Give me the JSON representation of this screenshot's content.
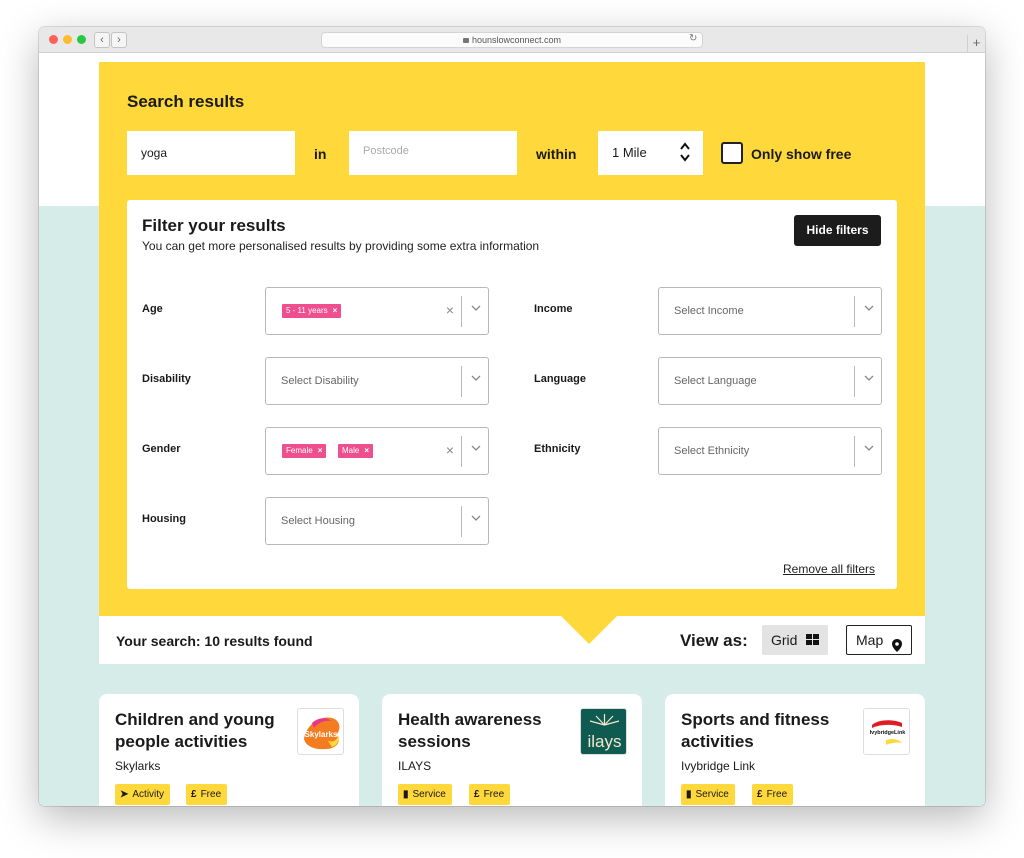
{
  "browser": {
    "url": "hounslowconnect.com",
    "back_glyph": "‹",
    "forward_glyph": "›",
    "reload_glyph": "↻",
    "new_tab_glyph": "+"
  },
  "search": {
    "title": "Search results",
    "query_value": "yoga",
    "in_label": "in",
    "postcode_placeholder": "Postcode",
    "within_label": "within",
    "distance_value": "1 Mile",
    "only_free_label": "Only show free"
  },
  "filters": {
    "title": "Filter your results",
    "subtitle": "You can get more personalised results by providing some extra information",
    "hide_button": "Hide filters",
    "remove_all": "Remove all filters",
    "age": {
      "label": "Age",
      "chips": [
        "5 - 11 years"
      ]
    },
    "income": {
      "label": "Income",
      "placeholder": "Select Income"
    },
    "disability": {
      "label": "Disability",
      "placeholder": "Select Disability"
    },
    "language": {
      "label": "Language",
      "placeholder": "Select Language"
    },
    "gender": {
      "label": "Gender",
      "chips": [
        "Female",
        "Male"
      ]
    },
    "ethnicity": {
      "label": "Ethnicity",
      "placeholder": "Select Ethnicity"
    },
    "housing": {
      "label": "Housing",
      "placeholder": "Select Housing"
    },
    "chip_remove_glyph": "×",
    "clear_glyph": "×",
    "dropdown_glyph": "⌄"
  },
  "results": {
    "count_text": "Your search: 10 results found",
    "view_as_label": "View as:",
    "grid_label": "Grid",
    "map_label": "Map"
  },
  "cards": [
    {
      "title": "Children and young people activities",
      "org": "Skylarks",
      "logo_text": "Skylarks",
      "tags": [
        {
          "icon": "➤",
          "label": "Activity"
        },
        {
          "icon": "£",
          "label": "Free"
        }
      ]
    },
    {
      "title": "Health awareness sessions",
      "org": "ILAYS",
      "logo_text": "ilays",
      "tags": [
        {
          "icon": "▮",
          "label": "Service"
        },
        {
          "icon": "£",
          "label": "Free"
        }
      ]
    },
    {
      "title": "Sports and fitness activities",
      "org": "Ivybridge Link",
      "logo_text": "IvybridgeLink",
      "tags": [
        {
          "icon": "▮",
          "label": "Service"
        },
        {
          "icon": "£",
          "label": "Free"
        }
      ]
    }
  ],
  "colors": {
    "accent_yellow": "#ffd83b",
    "chip_pink": "#ef4f8f",
    "mint_background": "#d6ece8",
    "dark_button": "#1c1c1c"
  }
}
